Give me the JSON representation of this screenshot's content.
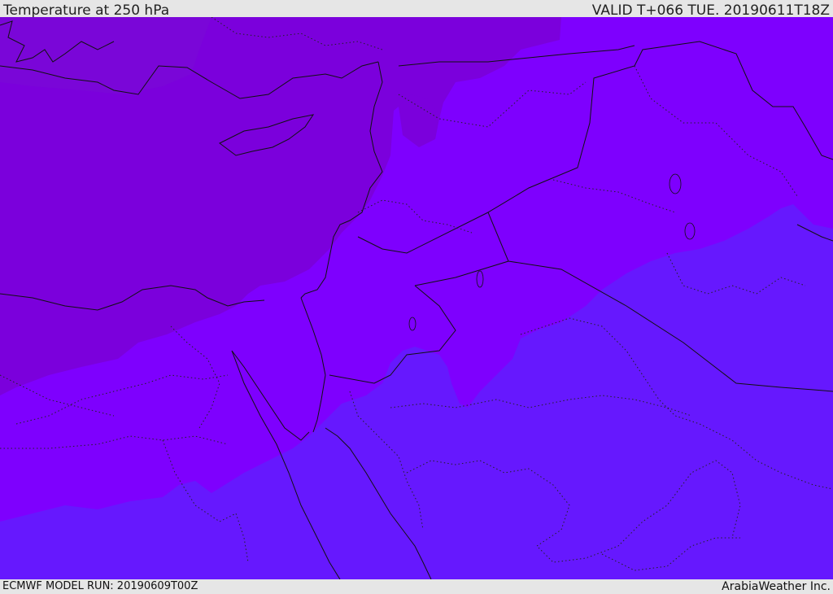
{
  "header": {
    "title": "Temperature at 250 hPa",
    "valid": "VALID T+066 TUE. 20190611T18Z"
  },
  "footer": {
    "model_run": "ECMWF MODEL RUN: 20190609T00Z",
    "credit": "ArabiaWeather Inc."
  },
  "colors": {
    "cold_band": "#7b00dc",
    "mid_band": "#7e00fe",
    "warm_band": "#6618fe",
    "border_line": "#111111",
    "background": "#e6e6e6"
  }
}
